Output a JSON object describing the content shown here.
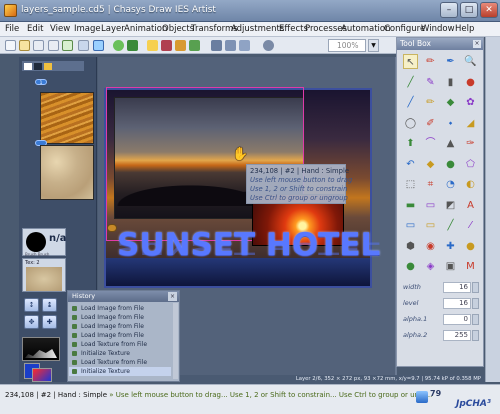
{
  "window": {
    "title": "layers_sample.cd5 | Chasys Draw IES Artist",
    "minimize_glyph": "–",
    "maximize_glyph": "□",
    "close_glyph": "✕"
  },
  "menu": [
    "File",
    "Edit",
    "View",
    "Image",
    "Layer",
    "Animation",
    "Objects",
    "Transforms",
    "Adjustments",
    "Effects",
    "Processes",
    "Automation",
    "Configure",
    "Window",
    "Help"
  ],
  "toolbar": {
    "zoom": "100%",
    "zoom_arrow": "▼"
  },
  "layers": {
    "badge": "1"
  },
  "brush": {
    "value": "n/a",
    "label": "Brush Brush"
  },
  "texture": {
    "label": "Tex: 2"
  },
  "controls": {
    "up": "↕",
    "down": "↨",
    "left": "✥",
    "right": "✚"
  },
  "canvas": {
    "headline": "SUNSET HOTEL",
    "cursor_glyph": "✋"
  },
  "tooltip": {
    "line1": "234,108 | #2 | Hand : Simple",
    "line2": "Use left mouse button to drag",
    "line3": "Use 1, 2 or Shift to constrain",
    "line4": "Use Ctrl to group or ungroup"
  },
  "history": {
    "title": "History",
    "close_glyph": "×",
    "items": [
      "Load Image from File",
      "Load Image from File",
      "Load Image from File",
      "Load Image from File",
      "Load Texture from File",
      "Initialize Texture",
      "Load Texture from File",
      "Initialize Texture"
    ]
  },
  "toolbox": {
    "title": "Tool Box",
    "close_glyph": "×",
    "params": [
      {
        "label": "width",
        "value": "16"
      },
      {
        "label": "level",
        "value": "16"
      },
      {
        "label": "alpha.1",
        "value": "0"
      },
      {
        "label": "alpha.2",
        "value": "255"
      }
    ],
    "tools": [
      "↖",
      "✏",
      "✒",
      "🔍",
      "╱",
      "✎",
      "▮",
      "●",
      "╱",
      "✏",
      "◆",
      "✿",
      "◯",
      "✐",
      "⬩",
      "◢",
      "⬆",
      "⌒",
      "▲",
      "✑",
      "↶",
      "◆",
      "●",
      "⬠",
      "⬚",
      "⌗",
      "◔",
      "◐",
      "▬",
      "▭",
      "◩",
      "A",
      "▭",
      "▭",
      "╱",
      "⁄",
      "⬢",
      "◉",
      "✚",
      "●",
      "●",
      "◈",
      "▣",
      "M"
    ]
  },
  "info_bar": "Layer 2/6, 352 × 272 px, 93 ×72 mm, x/y=9.7 | 95.74 kP of 0.358 MP",
  "status": {
    "coords": "234,108 | #2 | Hand : Simple",
    "hint": "Use left mouse button to drag... Use 1, 2 or Shift to constrain... Use Ctrl to group or ungr...",
    "number": "79",
    "logo": "JpCHA³"
  }
}
